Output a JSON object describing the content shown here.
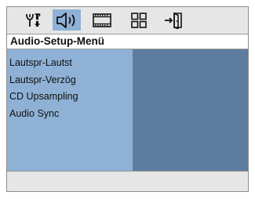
{
  "tabs": [
    {
      "icon": "general-setup-icon",
      "active": false
    },
    {
      "icon": "speaker-icon",
      "active": true
    },
    {
      "icon": "video-setup-icon",
      "active": false
    },
    {
      "icon": "preferences-icon",
      "active": false
    },
    {
      "icon": "exit-icon",
      "active": false
    }
  ],
  "menu": {
    "title": "Audio-Setup-Menü",
    "items": [
      "Lautspr-Lautst",
      "Lautspr-Verzög",
      "CD Upsampling",
      "Audio Sync"
    ]
  },
  "colors": {
    "panel": "#e6e6e6",
    "active_tab": "#8fb1d6",
    "list_bg": "#8fb1d6",
    "submenu_bg": "#5e7ca0"
  }
}
